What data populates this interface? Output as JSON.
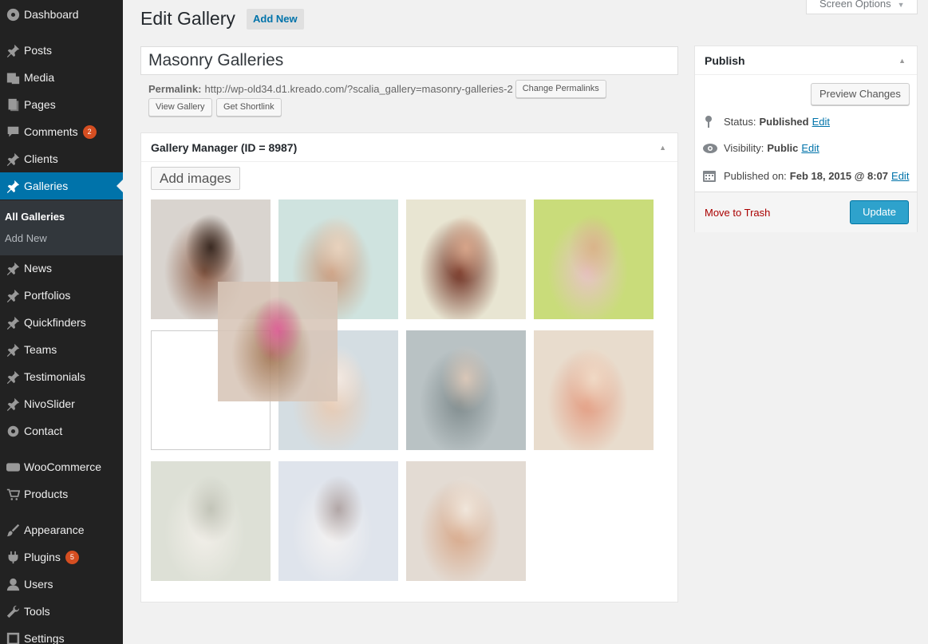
{
  "sidebar": {
    "items": [
      {
        "label": "Dashboard",
        "icon": "dashboard-icon"
      },
      {
        "label": "Posts",
        "icon": "pin-icon"
      },
      {
        "label": "Media",
        "icon": "media-icon"
      },
      {
        "label": "Pages",
        "icon": "pages-icon"
      },
      {
        "label": "Comments",
        "icon": "comment-icon",
        "badge": "2"
      },
      {
        "label": "Clients",
        "icon": "pin-icon"
      },
      {
        "label": "Galleries",
        "icon": "pin-icon",
        "active": true
      },
      {
        "label": "News",
        "icon": "pin-icon"
      },
      {
        "label": "Portfolios",
        "icon": "pin-icon"
      },
      {
        "label": "Quickfinders",
        "icon": "pin-icon"
      },
      {
        "label": "Teams",
        "icon": "pin-icon"
      },
      {
        "label": "Testimonials",
        "icon": "pin-icon"
      },
      {
        "label": "NivoSlider",
        "icon": "pin-icon"
      },
      {
        "label": "Contact",
        "icon": "gear-icon"
      },
      {
        "label": "WooCommerce",
        "icon": "woo-icon"
      },
      {
        "label": "Products",
        "icon": "cart-icon"
      },
      {
        "label": "Appearance",
        "icon": "brush-icon"
      },
      {
        "label": "Plugins",
        "icon": "plug-icon",
        "badge": "5"
      },
      {
        "label": "Users",
        "icon": "user-icon"
      },
      {
        "label": "Tools",
        "icon": "wrench-icon"
      },
      {
        "label": "Settings",
        "icon": "settings-icon"
      }
    ],
    "submenu": [
      {
        "label": "All Galleries",
        "current": true
      },
      {
        "label": "Add New",
        "current": false
      }
    ]
  },
  "header": {
    "title": "Edit Gallery",
    "add_new": "Add New",
    "screen_options": "Screen Options"
  },
  "post": {
    "title": "Masonry Galleries",
    "permalink_label": "Permalink:",
    "permalink_url": "http://wp-old34.d1.kreado.com/?scalia_gallery=masonry-galleries-2",
    "change_permalinks": "Change Permalinks",
    "view_gallery": "View Gallery",
    "get_shortlink": "Get Shortlink"
  },
  "gallery_manager": {
    "title": "Gallery Manager (ID = 8987)",
    "add_images": "Add images",
    "thumbnails": [
      {
        "name": "model-in-lingerie-on-white-chair",
        "colors": [
          "#d9d4cf",
          "#8a5a44",
          "#3a2a22"
        ]
      },
      {
        "name": "model-sitting-on-light-blue-background",
        "colors": [
          "#cfe3df",
          "#c99a7c",
          "#e8d2bd"
        ]
      },
      {
        "name": "red-haired-woman-with-red-lips",
        "colors": [
          "#e8e5d2",
          "#6b2a1c",
          "#d6a489"
        ]
      },
      {
        "name": "woman-with-flower-crown",
        "colors": [
          "#c9dc7a",
          "#e8c3c8",
          "#d9b48a"
        ]
      },
      {
        "name": "empty-drop-placeholder",
        "colors": []
      },
      {
        "name": "woman-lying-on-bed",
        "colors": [
          "#d4dde2",
          "#e8cab2",
          "#f2e8e1"
        ]
      },
      {
        "name": "blonde-woman-on-white-sofa",
        "colors": [
          "#b9c2c4",
          "#7f8b8d",
          "#d9c7b8"
        ]
      },
      {
        "name": "twin-women-in-pink",
        "colors": [
          "#e8dccd",
          "#e39b80",
          "#f0d9c5"
        ]
      },
      {
        "name": "blonde-woman-in-white-suit",
        "colors": [
          "#dde0d6",
          "#f2efe9",
          "#c2c4b8"
        ]
      },
      {
        "name": "woman-with-sunglasses-in-white-fur",
        "colors": [
          "#dfe4ec",
          "#f5f3f2",
          "#b1a6a6"
        ]
      },
      {
        "name": "woman-in-white-dress-with-flowers",
        "colors": [
          "#e3dbd3",
          "#d7a788",
          "#f0e6db"
        ]
      },
      {
        "name": "dragged-portrait-with-pink-lips",
        "colors": [
          "#d8c6b8",
          "#9a6a44",
          "#d8508a"
        ]
      }
    ]
  },
  "publish": {
    "title": "Publish",
    "preview": "Preview Changes",
    "status_label": "Status:",
    "status_value": "Published",
    "visibility_label": "Visibility:",
    "visibility_value": "Public",
    "published_label": "Published on:",
    "published_value": "Feb 18, 2015 @ 8:07",
    "edit": "Edit",
    "move_to_trash": "Move to Trash",
    "update": "Update"
  },
  "colors": {
    "sidebar_bg": "#222222",
    "active_menu": "#0073aa",
    "primary_button": "#2ea2cc",
    "badge": "#d54e21",
    "trash_link": "#aa0000"
  }
}
